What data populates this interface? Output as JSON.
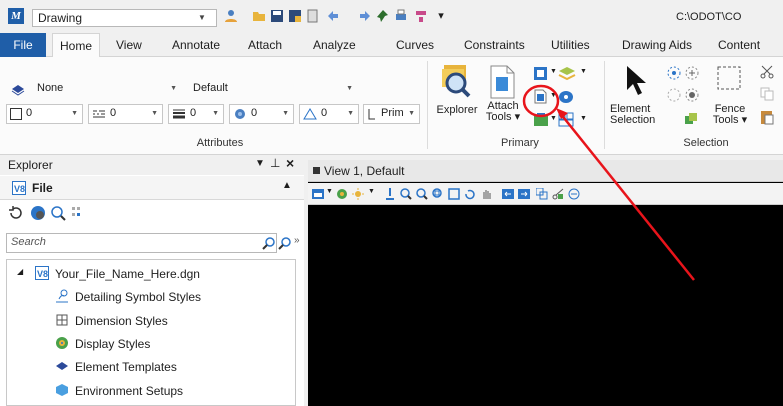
{
  "title_bar": {
    "workspace": "Drawing",
    "path": "C:\\ODOT\\CO"
  },
  "tabs": [
    {
      "label": "File"
    },
    {
      "label": "Home"
    },
    {
      "label": "View"
    },
    {
      "label": "Annotate"
    },
    {
      "label": "Attach"
    },
    {
      "label": "Analyze"
    },
    {
      "label": "Curves"
    },
    {
      "label": "Constraints"
    },
    {
      "label": "Utilities"
    },
    {
      "label": "Drawing Aids"
    },
    {
      "label": "Content"
    }
  ],
  "attributes": {
    "level": "None",
    "style_set": "Default",
    "group_label": "Attributes",
    "row2": [
      {
        "value": "0"
      },
      {
        "value": "0"
      },
      {
        "value": "0"
      },
      {
        "value": "0"
      },
      {
        "value": "0"
      },
      {
        "value": "Prim"
      }
    ]
  },
  "primary": {
    "group_label": "Primary",
    "explorer": "Explorer",
    "attach_tools": [
      "Attach",
      "Tools"
    ]
  },
  "selection": {
    "group_label": "Selection",
    "element_selection": [
      "Element",
      "Selection"
    ],
    "fence_tools": [
      "Fence",
      "Tools"
    ]
  },
  "explorer_panel": {
    "title": "Explorer",
    "section": "File",
    "search_placeholder": "Search",
    "tree": [
      {
        "label": "Your_File_Name_Here.dgn",
        "icon": "dgn-file-icon"
      },
      {
        "label": "Detailing Symbol Styles",
        "icon": "detailing-symbol-icon"
      },
      {
        "label": "Dimension Styles",
        "icon": "dimension-style-icon"
      },
      {
        "label": "Display Styles",
        "icon": "display-style-icon"
      },
      {
        "label": "Element Templates",
        "icon": "element-template-icon"
      },
      {
        "label": "Environment Setups",
        "icon": "environment-setup-icon"
      }
    ]
  },
  "view": {
    "title": "View 1, Default"
  },
  "annotation": {
    "color": "#e8141b"
  }
}
